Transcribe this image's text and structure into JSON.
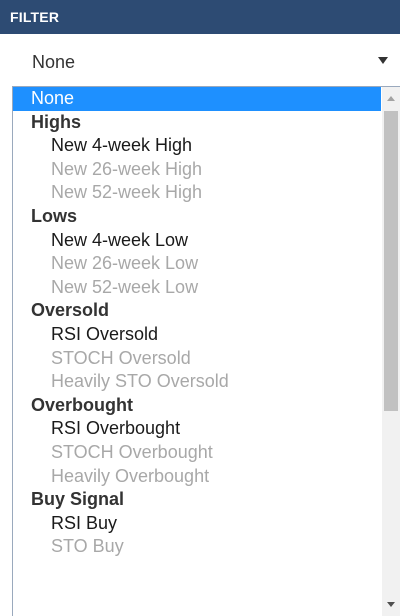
{
  "header": {
    "title": "FILTER"
  },
  "select": {
    "value": "None"
  },
  "dropdown": {
    "options": [
      {
        "label": "None",
        "kind": "selected"
      },
      {
        "label": "Highs",
        "kind": "group"
      },
      {
        "label": "New 4-week High",
        "kind": "item"
      },
      {
        "label": "New 26-week High",
        "kind": "disabled"
      },
      {
        "label": "New 52-week High",
        "kind": "disabled"
      },
      {
        "label": "Lows",
        "kind": "group"
      },
      {
        "label": "New 4-week Low",
        "kind": "item"
      },
      {
        "label": "New 26-week Low",
        "kind": "disabled"
      },
      {
        "label": "New 52-week Low",
        "kind": "disabled"
      },
      {
        "label": "Oversold",
        "kind": "group"
      },
      {
        "label": "RSI Oversold",
        "kind": "item"
      },
      {
        "label": "STOCH Oversold",
        "kind": "disabled"
      },
      {
        "label": "Heavily STO Oversold",
        "kind": "disabled"
      },
      {
        "label": "Overbought",
        "kind": "group"
      },
      {
        "label": "RSI Overbought",
        "kind": "item"
      },
      {
        "label": "STOCH Overbought",
        "kind": "disabled"
      },
      {
        "label": "Heavily Overbought",
        "kind": "disabled"
      },
      {
        "label": "Buy Signal",
        "kind": "group"
      },
      {
        "label": "RSI Buy",
        "kind": "item"
      },
      {
        "label": "STO Buy",
        "kind": "disabled"
      }
    ]
  },
  "colors": {
    "header_bg": "#2d4b73",
    "selected_bg": "#1e90ff",
    "disabled_text": "#a8a8a8"
  },
  "icons": {
    "select_arrow": "caret-down-icon",
    "scroll_up": "scroll-up-arrow-icon",
    "scroll_down": "scroll-down-arrow-icon"
  }
}
